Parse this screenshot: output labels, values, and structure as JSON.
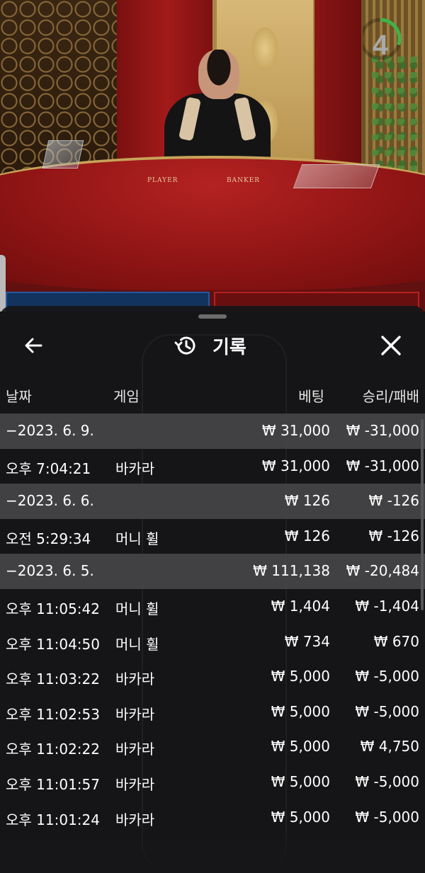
{
  "timer": {
    "value": "4",
    "ring_color": "#3fb24a",
    "progress": 0.3
  },
  "video": {
    "player_label": "PLAYER",
    "banker_label": "BANKER"
  },
  "sheet": {
    "title": "기록",
    "icons": {
      "back": "arrow-left-icon",
      "history": "history-clock-icon",
      "close": "close-icon"
    },
    "columns": {
      "date": "날짜",
      "game": "게임",
      "bet": "베팅",
      "result": "승리/패배"
    },
    "rows": [
      {
        "type": "group",
        "date": "−2023. 6. 9.",
        "game": "",
        "bet": "₩ 31,000",
        "result": "₩ -31,000"
      },
      {
        "type": "item",
        "date": "오후 7:04:21",
        "game": "바카라",
        "bet": "₩ 31,000",
        "result": "₩ -31,000"
      },
      {
        "type": "group",
        "date": "−2023. 6. 6.",
        "game": "",
        "bet": "₩ 126",
        "result": "₩ -126"
      },
      {
        "type": "item",
        "date": "오전 5:29:34",
        "game": "머니 휠",
        "bet": "₩ 126",
        "result": "₩ -126"
      },
      {
        "type": "group",
        "date": "−2023. 6. 5.",
        "game": "",
        "bet": "₩ 111,138",
        "result": "₩ -20,484"
      },
      {
        "type": "item",
        "date": "오후 11:05:42",
        "game": "머니 휠",
        "bet": "₩ 1,404",
        "result": "₩ -1,404"
      },
      {
        "type": "item",
        "date": "오후 11:04:50",
        "game": "머니 휠",
        "bet": "₩ 734",
        "result": "₩ 670"
      },
      {
        "type": "item",
        "date": "오후 11:03:22",
        "game": "바카라",
        "bet": "₩ 5,000",
        "result": "₩ -5,000"
      },
      {
        "type": "item",
        "date": "오후 11:02:53",
        "game": "바카라",
        "bet": "₩ 5,000",
        "result": "₩ -5,000"
      },
      {
        "type": "item",
        "date": "오후 11:02:22",
        "game": "바카라",
        "bet": "₩ 5,000",
        "result": "₩ 4,750"
      },
      {
        "type": "item",
        "date": "오후 11:01:57",
        "game": "바카라",
        "bet": "₩ 5,000",
        "result": "₩ -5,000"
      },
      {
        "type": "item",
        "date": "오후 11:01:24",
        "game": "바카라",
        "bet": "₩ 5,000",
        "result": "₩ -5,000"
      }
    ]
  }
}
